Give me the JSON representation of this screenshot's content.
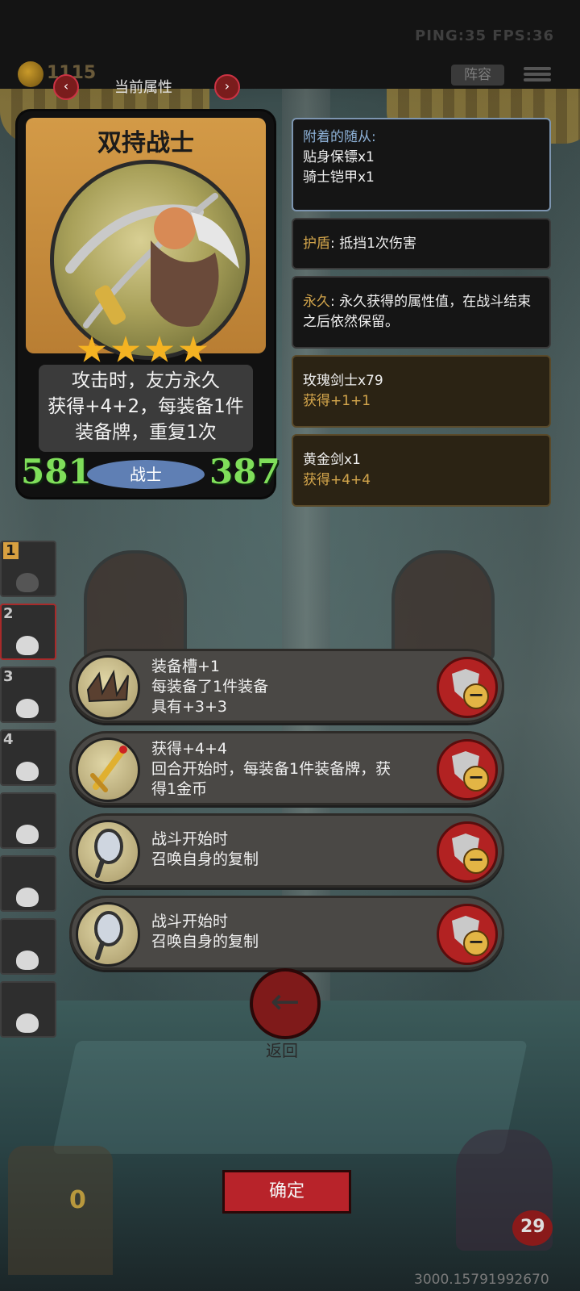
{
  "status": {
    "ping_fps": "PING:35   FPS:36"
  },
  "topbar": {
    "gold": "1115",
    "tab_title": "当前属性",
    "lineup": "阵容"
  },
  "card": {
    "name": "双持战士",
    "stars": 4,
    "desc": [
      "攻击时，友方永久",
      "获得+4+2，每装备1件",
      "装备牌，重复1次"
    ],
    "attack": "581",
    "health": "387",
    "class": "战士"
  },
  "panels": {
    "attached": {
      "title": "附着的随从:",
      "lines": [
        "贴身保镖x1",
        "骑士铠甲x1"
      ]
    },
    "shield": {
      "key": "护盾",
      "text": ": 抵挡1次伤害"
    },
    "permanent": {
      "key": "永久",
      "text": ": 永久获得的属性值，在战斗结束之后依然保留。"
    },
    "buff1": {
      "name": "玫瑰剑士x79",
      "value": "获得+1+1"
    },
    "buff2": {
      "name": "黄金剑x1",
      "value": "获得+4+4"
    }
  },
  "team": [
    "1",
    "2",
    "3",
    "4",
    "",
    "",
    "",
    ""
  ],
  "equipment": [
    {
      "icon": "spikes-icon",
      "lines": [
        "装备槽+1",
        "每装备了1件装备",
        "具有+3+3"
      ]
    },
    {
      "icon": "golden-sword-icon",
      "lines": [
        "获得+4+4",
        "回合开始时，每装备1件装备牌，获",
        "得1金币"
      ]
    },
    {
      "icon": "mirror-icon",
      "lines": [
        "战斗开始时",
        "召唤自身的复制"
      ]
    },
    {
      "icon": "mirror-icon",
      "lines": [
        "战斗开始时",
        "召唤自身的复制"
      ]
    }
  ],
  "back": {
    "label": "返回"
  },
  "confirm": {
    "label": "确定"
  },
  "bottom": {
    "chest_count": "0",
    "enemy_health": "29",
    "coords": "3000.15791992670"
  }
}
